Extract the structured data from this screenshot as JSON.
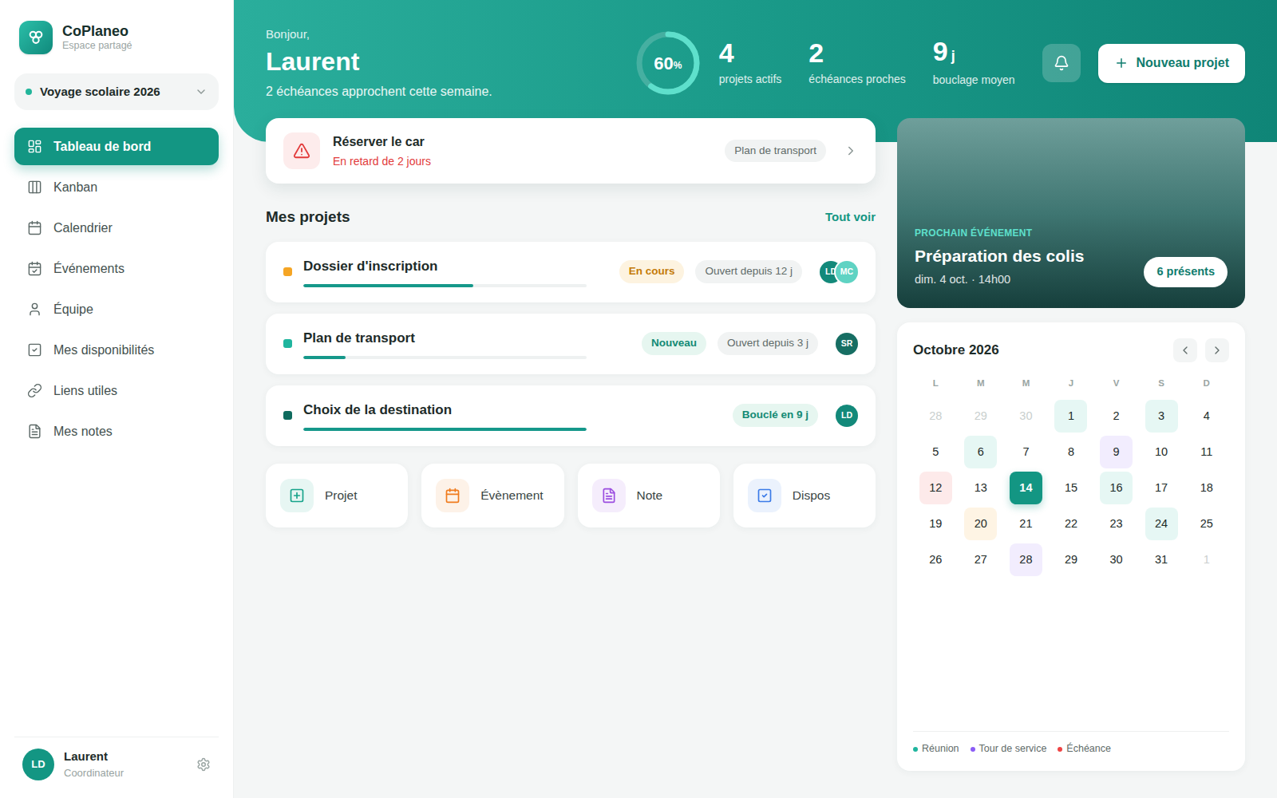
{
  "sidebar": {
    "brand": {
      "name": "CoPlaneo",
      "subtitle": "Espace partagé"
    },
    "workspace": {
      "label": "Voyage scolaire 2026",
      "color": "#22b59a"
    },
    "items": [
      {
        "label": "Tableau de bord",
        "selected": true
      },
      {
        "label": "Kanban",
        "selected": false
      },
      {
        "label": "Calendrier",
        "selected": false
      },
      {
        "label": "Événements",
        "selected": false
      },
      {
        "label": "Équipe",
        "selected": false
      },
      {
        "label": "Mes disponibilités",
        "selected": false
      },
      {
        "label": "Liens utiles",
        "selected": false
      },
      {
        "label": "Mes notes",
        "selected": false
      }
    ],
    "user": {
      "initials": "LD",
      "name": "Laurent",
      "role": "Coordinateur"
    }
  },
  "header": {
    "greeting": "Bonjour,",
    "name": "Laurent",
    "subtitle": "2 échéances approchent cette semaine.",
    "progress": {
      "value": "60",
      "unit": "%",
      "level": 0.6
    },
    "stats": [
      {
        "value": "4",
        "unit": "",
        "label": "projets actifs"
      },
      {
        "value": "2",
        "unit": "",
        "label": "échéances proches"
      },
      {
        "value": "9",
        "unit": "j",
        "label": "bouclage moyen"
      }
    ],
    "new_button": "Nouveau projet"
  },
  "alert": {
    "title": "Réserver le car",
    "detail": "En retard de 2 jours",
    "tag": "Plan de transport"
  },
  "projects": {
    "title": "Mes projets",
    "link": "Tout voir",
    "rows": [
      {
        "name": "Dossier d'inscription",
        "color": "#f5a524",
        "level": 0.6,
        "status": {
          "label": "En cours",
          "kind": "progress"
        },
        "age": "Ouvert depuis 12 j",
        "members": [
          {
            "initials": "LD",
            "color": "#13897a"
          },
          {
            "initials": "MC",
            "color": "#5fd3c3"
          }
        ]
      },
      {
        "name": "Plan de transport",
        "color": "#1fb59e",
        "level": 0.15,
        "status": {
          "label": "Nouveau",
          "kind": "new"
        },
        "age": "Ouvert depuis 3 j",
        "members": [
          {
            "initials": "SR",
            "color": "#176e63"
          }
        ]
      },
      {
        "name": "Choix de la destination",
        "color": "#0f6b5e",
        "level": 1,
        "status": {
          "label": "Bouclé en 9 j",
          "kind": "done"
        },
        "age": "",
        "members": [
          {
            "initials": "LD",
            "color": "#13897a"
          }
        ]
      }
    ]
  },
  "quick_actions": [
    {
      "label": "Projet",
      "color": "#16a38a"
    },
    {
      "label": "Évènement",
      "color": "#f07b1d"
    },
    {
      "label": "Note",
      "color": "#9b4de0"
    },
    {
      "label": "Dispos",
      "color": "#3b7be8"
    }
  ],
  "event": {
    "eyebrow": "PROCHAIN ÉVÉNEMENT",
    "title": "Préparation des colis",
    "when": "dim. 4 oct. · 14h00",
    "attendees": "6 présents"
  },
  "calendar": {
    "month": "Octobre 2026",
    "weekdays": [
      "L",
      "M",
      "M",
      "J",
      "V",
      "S",
      "D"
    ],
    "days": [
      {
        "day": "28",
        "outside": true,
        "selected": false
      },
      {
        "day": "29",
        "outside": true,
        "selected": false
      },
      {
        "day": "30",
        "outside": true,
        "selected": false
      },
      {
        "day": "1",
        "outside": false,
        "selected": false,
        "color": "#1fb59e"
      },
      {
        "day": "2",
        "outside": false,
        "selected": false
      },
      {
        "day": "3",
        "outside": false,
        "selected": false,
        "color": "#1fb59e"
      },
      {
        "day": "4",
        "outside": false,
        "selected": false
      },
      {
        "day": "5",
        "outside": false,
        "selected": false
      },
      {
        "day": "6",
        "outside": false,
        "selected": false,
        "color": "#1fb59e"
      },
      {
        "day": "7",
        "outside": false,
        "selected": false
      },
      {
        "day": "8",
        "outside": false,
        "selected": false
      },
      {
        "day": "9",
        "outside": false,
        "selected": false,
        "color": "#8b5cf6"
      },
      {
        "day": "10",
        "outside": false,
        "selected": false
      },
      {
        "day": "11",
        "outside": false,
        "selected": false
      },
      {
        "day": "12",
        "outside": false,
        "selected": false,
        "color": "#ef4444"
      },
      {
        "day": "13",
        "outside": false,
        "selected": false
      },
      {
        "day": "14",
        "outside": false,
        "selected": true
      },
      {
        "day": "15",
        "outside": false,
        "selected": false
      },
      {
        "day": "16",
        "outside": false,
        "selected": false,
        "color": "#1fb59e"
      },
      {
        "day": "17",
        "outside": false,
        "selected": false
      },
      {
        "day": "18",
        "outside": false,
        "selected": false
      },
      {
        "day": "19",
        "outside": false,
        "selected": false
      },
      {
        "day": "20",
        "outside": false,
        "selected": false,
        "color": "#f59e0b"
      },
      {
        "day": "21",
        "outside": false,
        "selected": false
      },
      {
        "day": "22",
        "outside": false,
        "selected": false
      },
      {
        "day": "23",
        "outside": false,
        "selected": false
      },
      {
        "day": "24",
        "outside": false,
        "selected": false,
        "color": "#1fb59e"
      },
      {
        "day": "25",
        "outside": false,
        "selected": false
      },
      {
        "day": "26",
        "outside": false,
        "selected": false
      },
      {
        "day": "27",
        "outside": false,
        "selected": false
      },
      {
        "day": "28",
        "outside": false,
        "selected": false,
        "color": "#8b5cf6"
      },
      {
        "day": "29",
        "outside": false,
        "selected": false
      },
      {
        "day": "30",
        "outside": false,
        "selected": false
      },
      {
        "day": "31",
        "outside": false,
        "selected": false
      },
      {
        "day": "1",
        "outside": true,
        "selected": false
      }
    ],
    "legend": [
      {
        "label": "Réunion",
        "color": "#1fb59e"
      },
      {
        "label": "Tour de service",
        "color": "#8b5cf6"
      },
      {
        "label": "Échéance",
        "color": "#ef4444"
      }
    ]
  }
}
